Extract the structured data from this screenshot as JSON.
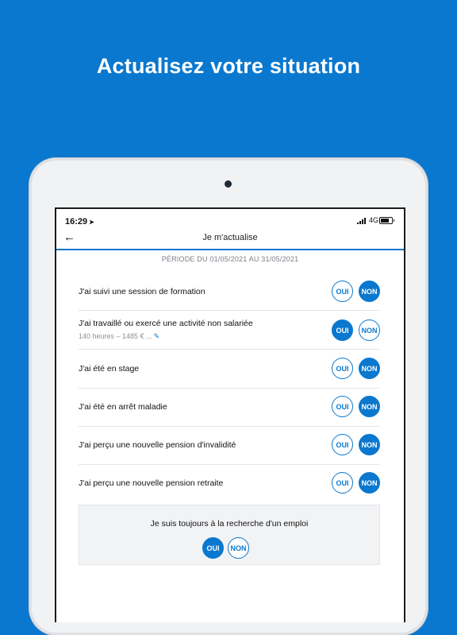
{
  "headline": "Actualisez votre situation",
  "status": {
    "time": "16:29",
    "network": "4G"
  },
  "nav": {
    "title": "Je m'actualise"
  },
  "period": "PÉRIODE DU 01/05/2021 AU 31/05/2021",
  "yes_label": "OUI",
  "no_label": "NON",
  "questions": [
    {
      "text": "J'ai suivi une session de formation",
      "answer": "NON"
    },
    {
      "text": "J'ai travaillé ou exercé une activité non salariée",
      "detail": "140 heures – 1485 € ...",
      "answer": "OUI"
    },
    {
      "text": "J'ai été en stage",
      "answer": "NON"
    },
    {
      "text": "J'ai été en arrêt maladie",
      "answer": "NON"
    },
    {
      "text": "J'ai perçu une nouvelle pension d'invalidité",
      "answer": "NON"
    },
    {
      "text": "J'ai perçu une nouvelle pension retraite",
      "answer": "NON"
    }
  ],
  "search": {
    "text": "Je suis toujours à la recherche d'un emploi",
    "answer": "OUI"
  },
  "colors": {
    "accent": "#0a78cf",
    "background": "#0a78cf",
    "divider": "#e3e5e8"
  },
  "icons": {
    "back": "arrow-left-icon",
    "location": "location-arrow-icon",
    "edit": "pencil-icon"
  }
}
